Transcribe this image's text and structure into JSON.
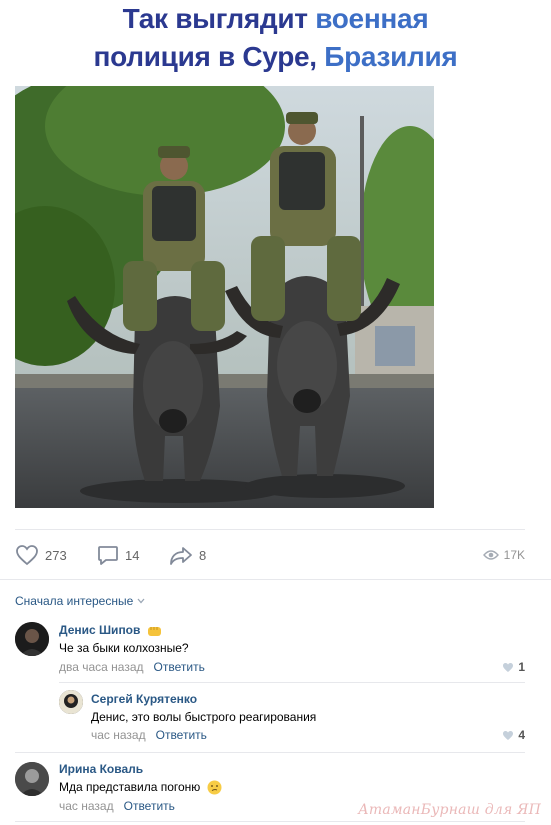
{
  "post": {
    "title_part1_dark": "Так выглядит ",
    "title_part1_hl": "военная",
    "title_part2_dark": "полиция в Суре, ",
    "title_part2_hl": "Бразилия",
    "photo_alt": "military-police-on-water-buffalo"
  },
  "actions": {
    "likes": "273",
    "comments": "14",
    "shares": "8",
    "views": "17K"
  },
  "sort": {
    "label": "Сначала интересные"
  },
  "comments": [
    {
      "author": "Денис Шипов",
      "text": "Че за быки колхозные?",
      "time": "два часа назад",
      "reply": "Ответить",
      "likes": "1"
    },
    {
      "author": "Сергей Курятенко",
      "text": "Денис, это волы быстрого реагирования",
      "time": "час назад",
      "reply": "Ответить",
      "likes": "4"
    },
    {
      "author": "Ирина Коваль",
      "text": "Мда представила погоню",
      "time": "час назад",
      "reply": "Ответить",
      "likes": ""
    }
  ],
  "watermark": "АтаманБурнаш для ЯП",
  "colors": {
    "title_dark": "#2b3990",
    "title_highlight": "#3d6fc6",
    "link": "#2a5885",
    "meta": "#939393"
  }
}
